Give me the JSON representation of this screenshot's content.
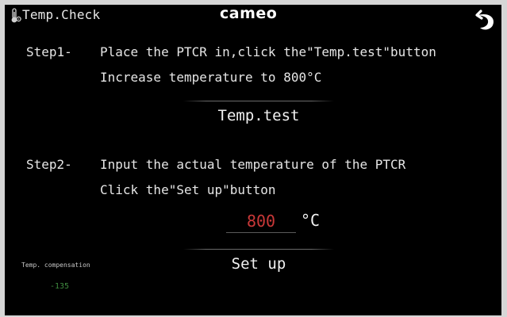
{
  "header": {
    "title": "Temp.Check",
    "brand": "cameo",
    "icon": "thermometer-gear-icon",
    "back_icon": "back-arrow-icon"
  },
  "step1": {
    "label": "Step1-",
    "line1": "Place the PTCR in,click the\"Temp.test\"button",
    "line2": "Increase temperature to 800°C",
    "button_label": "Temp.test"
  },
  "step2": {
    "label": "Step2-",
    "line1": "Input the actual temperature of the PTCR",
    "line2": "Click the\"Set up\"button",
    "input_value": "800",
    "unit": "°C",
    "button_label": "Set up"
  },
  "compensation": {
    "label": "Temp. compensation",
    "value": "-135"
  },
  "colors": {
    "background": "#000000",
    "text": "#e6e6e6",
    "input_value": "#c93838",
    "compensation_value": "#3f8a3f"
  }
}
